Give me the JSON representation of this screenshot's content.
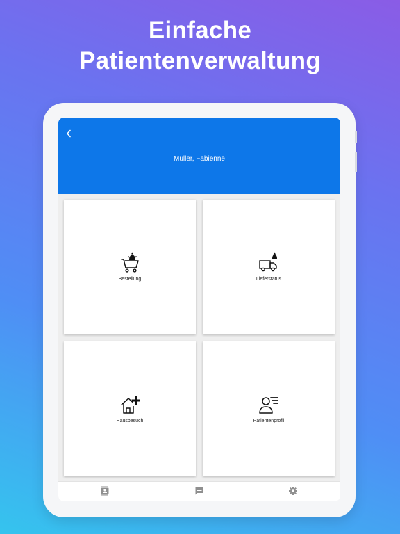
{
  "headline": {
    "line1": "Einfache",
    "line2": "Patientenverwaltung"
  },
  "header": {
    "back_icon": "chevron-left-icon",
    "patient_name": "Müller, Fabienne",
    "background_color": "#0d77e9"
  },
  "tiles": [
    {
      "label": "Bestellung",
      "icon": "cart-with-bell-icon"
    },
    {
      "label": "Lieferstatus",
      "icon": "truck-with-bell-icon"
    },
    {
      "label": "Hausbesuch",
      "icon": "house-plus-icon"
    },
    {
      "label": "Patientenprofil",
      "icon": "person-list-icon"
    }
  ],
  "bottom_nav": [
    {
      "icon": "contacts-icon"
    },
    {
      "icon": "chat-icon"
    },
    {
      "icon": "settings-gear-icon"
    }
  ],
  "colors": {
    "accent": "#0d77e9",
    "icon_gray": "#8f8f8f"
  }
}
